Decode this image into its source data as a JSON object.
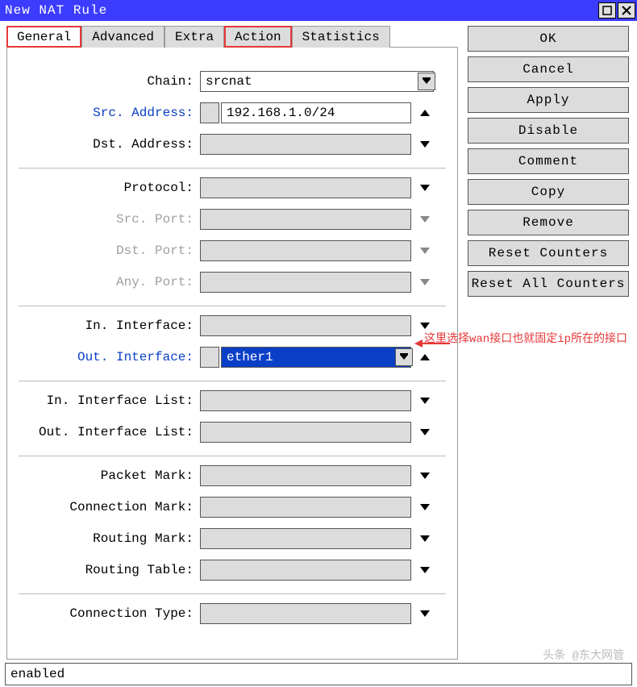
{
  "window": {
    "title": "New NAT Rule"
  },
  "tabs": [
    "General",
    "Advanced",
    "Extra",
    "Action",
    "Statistics"
  ],
  "fields": {
    "chain_label": "Chain:",
    "chain_value": "srcnat",
    "src_addr_label": "Src. Address:",
    "src_addr_value": "192.168.1.0/24",
    "dst_addr_label": "Dst. Address:",
    "protocol_label": "Protocol:",
    "src_port_label": "Src. Port:",
    "dst_port_label": "Dst. Port:",
    "any_port_label": "Any. Port:",
    "in_if_label": "In. Interface:",
    "out_if_label": "Out. Interface:",
    "out_if_value": "ether1",
    "in_if_list_label": "In. Interface List:",
    "out_if_list_label": "Out. Interface List:",
    "packet_mark_label": "Packet Mark:",
    "conn_mark_label": "Connection Mark:",
    "routing_mark_label": "Routing Mark:",
    "routing_table_label": "Routing Table:",
    "conn_type_label": "Connection Type:"
  },
  "buttons": {
    "ok": "OK",
    "cancel": "Cancel",
    "apply": "Apply",
    "disable": "Disable",
    "comment": "Comment",
    "copy": "Copy",
    "remove": "Remove",
    "reset_counters": "Reset Counters",
    "reset_all_counters": "Reset All Counters"
  },
  "status": "enabled",
  "annotation": "这里选择wan接口也就固定ip所在的接口",
  "watermark": "头条 @东大网管"
}
